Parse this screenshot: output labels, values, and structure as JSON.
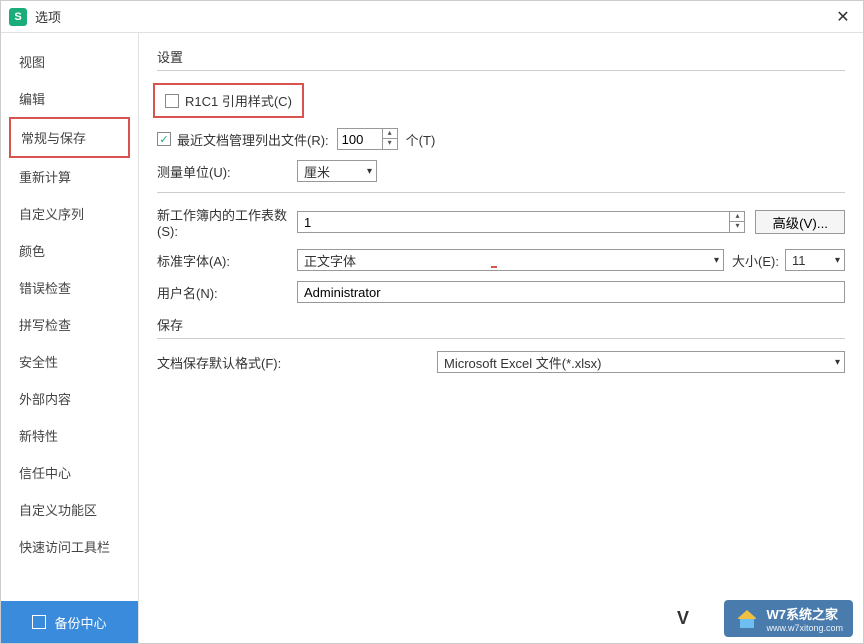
{
  "title": "选项",
  "close": "✕",
  "sidebar": {
    "items": [
      {
        "label": "视图"
      },
      {
        "label": "编辑"
      },
      {
        "label": "常规与保存"
      },
      {
        "label": "重新计算"
      },
      {
        "label": "自定义序列"
      },
      {
        "label": "颜色"
      },
      {
        "label": "错误检查"
      },
      {
        "label": "拼写检查"
      },
      {
        "label": "安全性"
      },
      {
        "label": "外部内容"
      },
      {
        "label": "新特性"
      },
      {
        "label": "信任中心"
      },
      {
        "label": "自定义功能区"
      },
      {
        "label": "快速访问工具栏"
      }
    ],
    "backup": "备份中心"
  },
  "settings": {
    "title": "设置",
    "r1c1": "R1C1 引用样式(C)",
    "recentFiles": "最近文档管理列出文件(R):",
    "recentValue": "100",
    "recentUnit": "个(T)",
    "unitLabel": "测量单位(U):",
    "unitValue": "厘米",
    "sheetsLabel": "新工作簿内的工作表数(S):",
    "sheetsValue": "1",
    "advanced": "高级(V)...",
    "fontLabel": "标准字体(A):",
    "fontValue": "正文字体",
    "sizeLabel": "大小(E):",
    "sizeValue": "11",
    "userLabel": "用户名(N):",
    "userValue": "Administrator"
  },
  "save": {
    "title": "保存",
    "formatLabel": "文档保存默认格式(F):",
    "formatValue": "Microsoft Excel 文件(*.xlsx)"
  },
  "watermark": {
    "v": "V",
    "text": "W7系统之家",
    "url": "www.w7xitong.com"
  }
}
